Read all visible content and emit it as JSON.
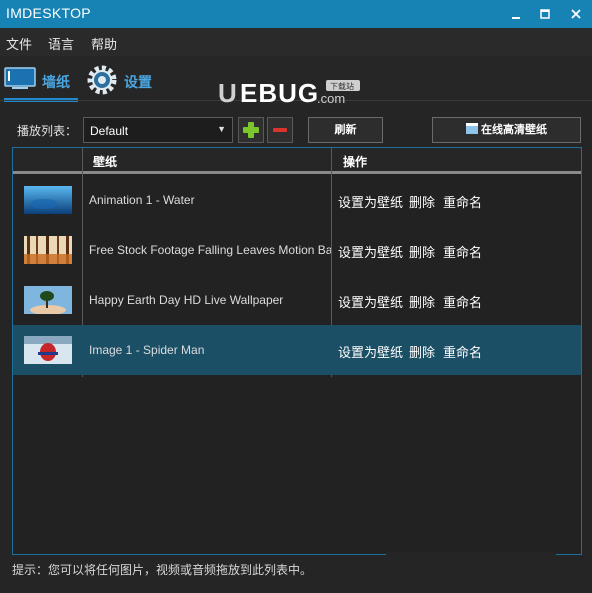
{
  "window": {
    "title": "IMDESKTOP"
  },
  "menu": {
    "items": [
      "文件",
      "语言",
      "帮助"
    ]
  },
  "tabs": [
    {
      "label": "墙纸",
      "icon": "desktop-icon",
      "active": true
    },
    {
      "label": "设置",
      "icon": "gear-icon",
      "active": false
    }
  ],
  "logo": {
    "text": "UEBUG",
    "suffix": ".com",
    "badge": "下载站"
  },
  "toolbar": {
    "playlist_label": "播放列表：",
    "playlist_value": "Default",
    "add_label": "+",
    "remove_label": "−",
    "refresh_label": "刷新",
    "online_label": "在线高清壁纸"
  },
  "table": {
    "columns": [
      "壁纸",
      "操作"
    ],
    "rows": [
      {
        "name": "Animation 1 - Water",
        "thumb": "water",
        "selected": false
      },
      {
        "name": "Free Stock Footage Falling Leaves Motion Backg",
        "thumb": "leaves",
        "selected": false
      },
      {
        "name": "Happy Earth Day HD Live Wallpaper",
        "thumb": "earth",
        "selected": false
      },
      {
        "name": "Image 1 - Spider Man",
        "thumb": "spiderman",
        "selected": true
      }
    ],
    "actions": [
      "设置为壁纸",
      "删除",
      "重命名"
    ]
  },
  "hint": "提示：您可以将任何图片，视频或音频拖放到此列表中。",
  "colors": {
    "titlebar": "#1783b5",
    "accent": "#4aa6e0",
    "selected_row": "#1a4f65",
    "add": "#7bc62d",
    "remove": "#d8342b"
  }
}
